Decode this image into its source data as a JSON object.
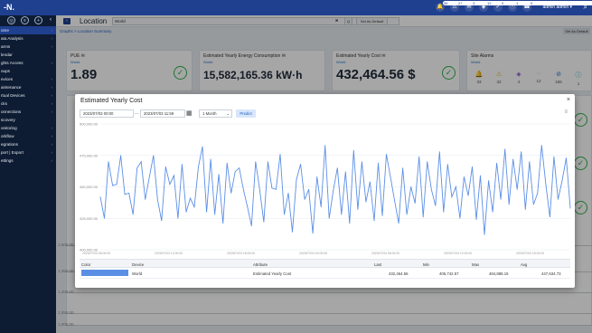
{
  "topbar": {
    "logo": "-N.",
    "icons": [
      {
        "name": "bell-alarm-icon",
        "glyph": "🔔",
        "badge": "36"
      },
      {
        "name": "warning-icon",
        "glyph": "⚠",
        "badge": "27"
      },
      {
        "name": "chat-icon",
        "glyph": "✉",
        "badge": "3"
      },
      {
        "name": "shield-icon",
        "glyph": "◈",
        "badge": "12"
      },
      {
        "name": "check-icon",
        "glyph": "✓",
        "badge": "0"
      },
      {
        "name": "info-icon",
        "glyph": "ⓘ",
        "badge": "1"
      },
      {
        "name": "phone-icon",
        "glyph": "☎",
        "badge": "0"
      }
    ],
    "user": "admin admin ▾"
  },
  "sidebar": {
    "items": [
      {
        "label": "ome",
        "active": true,
        "chevron": "‹"
      },
      {
        "label": "ata Analysis",
        "chevron": "‹"
      },
      {
        "label": "arms",
        "chevron": "‹"
      },
      {
        "label": "lendar",
        "chevron": ""
      },
      {
        "label": "ghts Access",
        "chevron": "‹"
      },
      {
        "label": "oups",
        "chevron": ""
      },
      {
        "label": "evices",
        "chevron": "‹"
      },
      {
        "label": "aintenance",
        "chevron": "‹"
      },
      {
        "label": "rtual Devices",
        "chevron": "‹"
      },
      {
        "label": "cks",
        "chevron": "‹"
      },
      {
        "label": "onnections",
        "chevron": "‹"
      },
      {
        "label": "scovery",
        "chevron": ""
      },
      {
        "label": "onitoring",
        "chevron": "‹"
      },
      {
        "label": "orkflow",
        "chevron": "‹"
      },
      {
        "label": "egrations",
        "chevron": "‹"
      },
      {
        "label": "port | Export",
        "chevron": "‹"
      },
      {
        "label": "ettings",
        "chevron": "‹"
      }
    ]
  },
  "location": {
    "title": "Location",
    "value": "World",
    "clear": "✖",
    "search": "Q",
    "set_default": "Set As Default"
  },
  "breadcrumb": {
    "path": "Graphs  > Location Summary",
    "set_default": "Set As Default"
  },
  "cards": {
    "pue": {
      "title": "PUE ✉",
      "sub": "World",
      "value": "1.89"
    },
    "energy": {
      "title": "Estimated Yearly Energy Consumption ✉",
      "sub": "World",
      "value": "15,582,165.36 kW·h"
    },
    "cost": {
      "title": "Estimated Yearly Cost ✉",
      "sub": "World",
      "value": "432,464.56 $"
    },
    "alarms": {
      "title": "Site Alarms",
      "sub": "World",
      "items": [
        {
          "icon": "bell-icon",
          "glyph": "🔔",
          "count": "33",
          "color": "#e02020"
        },
        {
          "icon": "warning-icon",
          "glyph": "⚠",
          "count": "32",
          "color": "#f0b400"
        },
        {
          "icon": "shield-icon",
          "glyph": "◈",
          "count": "4",
          "color": "#7a4fd0"
        },
        {
          "icon": "circle-icon",
          "glyph": "○",
          "count": "12",
          "color": "#c0c4ca"
        },
        {
          "icon": "no-entry-icon",
          "glyph": "⊘",
          "count": "155",
          "color": "#1f6fd0"
        },
        {
          "icon": "info-icon",
          "glyph": "ⓘ",
          "count": "1",
          "color": "#20b0c0"
        }
      ]
    }
  },
  "modal": {
    "title": "Estimated Yearly Cost",
    "close": "×",
    "start": "2023/07/03 00:00",
    "separator": "—",
    "end": "2023/07/03 11:59",
    "period": "1 Month",
    "period_arrow": "⌄",
    "predict": "Predict",
    "menu": "≡",
    "table": {
      "headers": {
        "color": "Color",
        "device": "Device",
        "attribute": "Attribute",
        "last": "Last",
        "min": "Min",
        "max": "Max",
        "avg": "Avg"
      },
      "rows": [
        {
          "device": "World",
          "attribute": "Estimated Yearly Cost",
          "last": "432,464.56",
          "min": "406,742.57",
          "max": "484,888.15",
          "avg": "447,634.73",
          "color": "#5b8fe6"
        }
      ]
    }
  },
  "background": {
    "ticks": [
      "1,500.00",
      "1,350.00",
      "1,200.00",
      "1,050.00",
      "1,000.00"
    ]
  },
  "chart_data": {
    "type": "line",
    "title": "",
    "xlabel": "",
    "ylabel": "",
    "ylim": [
      400000,
      500000
    ],
    "yticks": [
      "500,000.00",
      "475,000.00",
      "450,000.00",
      "425,000.00",
      "400,000.00"
    ],
    "xticks": [
      "2023/07/03 06:00:00",
      "2023/07/03 12:00:00",
      "2023/07/03 18:00:00",
      "2023/07/04 00:00:00",
      "2023/07/04 06:00:00",
      "2023/07/04 12:00:00",
      "2023/07/04 18:00:00"
    ],
    "grid": true,
    "series": [
      {
        "color": "#5b8fe6",
        "values": [
          442000,
          425000,
          470000,
          451000,
          452000,
          475000,
          444000,
          445000,
          428000,
          465000,
          470000,
          440000,
          458000,
          475000,
          440000,
          423000,
          466000,
          452000,
          459000,
          425000,
          468000,
          430000,
          441000,
          434000,
          466000,
          482000,
          430000,
          472000,
          428000,
          460000,
          421000,
          469000,
          445000,
          462000,
          465000,
          448000,
          434000,
          419000,
          470000,
          448000,
          422000,
          470000,
          449000,
          448000,
          476000,
          428000,
          445000,
          414000,
          456000,
          468000,
          440000,
          448000,
          413000,
          458000,
          434000,
          483000,
          425000,
          447000,
          465000,
          428000,
          462000,
          421000,
          479000,
          432000,
          470000,
          438000,
          454000,
          423000,
          469000,
          427000,
          476000,
          458000,
          439000,
          421000,
          465000,
          428000,
          450000,
          437000,
          474000,
          426000,
          470000,
          448000,
          435000,
          478000,
          430000,
          468000,
          442000,
          450000,
          425000,
          458000,
          443000,
          466000,
          424000,
          459000,
          412000,
          455000,
          430000,
          469000,
          440000,
          480000,
          436000,
          472000,
          448000,
          478000,
          432000,
          470000,
          436000,
          445000,
          483000,
          452000,
          426000,
          474000,
          440000,
          455000,
          473000,
          433000
        ]
      }
    ]
  }
}
